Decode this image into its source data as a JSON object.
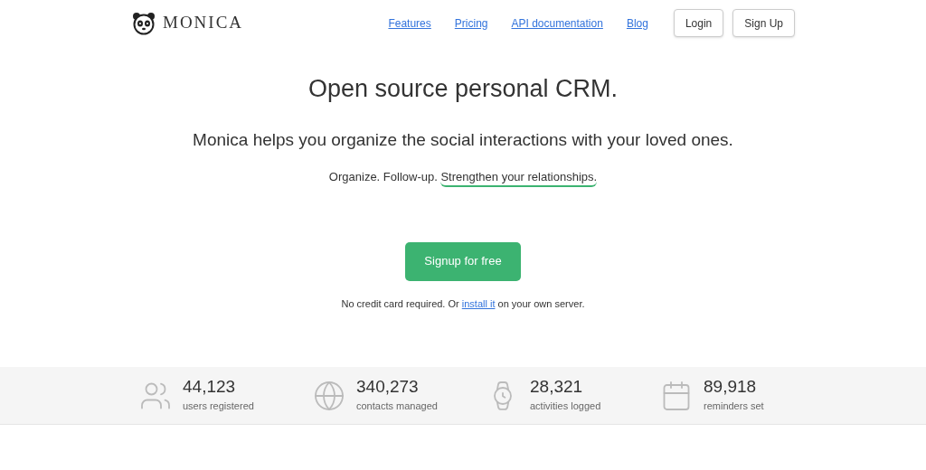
{
  "logo": {
    "text": "MONICA"
  },
  "nav": {
    "links": [
      "Features",
      "Pricing",
      "API documentation",
      "Blog"
    ],
    "buttons": [
      "Login",
      "Sign Up"
    ]
  },
  "hero": {
    "title": "Open source personal CRM.",
    "subtitle": "Monica helps you organize the social interactions with your loved ones.",
    "tagline": {
      "plain": "Organize. Follow-up. ",
      "underlined": "Strengthen your relationships."
    },
    "cta": "Signup for free",
    "note": {
      "before": "No credit card required. Or ",
      "link": "install it",
      "after": " on your own server."
    }
  },
  "stats": [
    {
      "kind": "users",
      "value": "44,123",
      "label": "users registered"
    },
    {
      "kind": "globe",
      "value": "340,273",
      "label": "contacts managed"
    },
    {
      "kind": "watch",
      "value": "28,321",
      "label": "activities logged"
    },
    {
      "kind": "calendar",
      "value": "89,918",
      "label": "reminders set"
    }
  ]
}
